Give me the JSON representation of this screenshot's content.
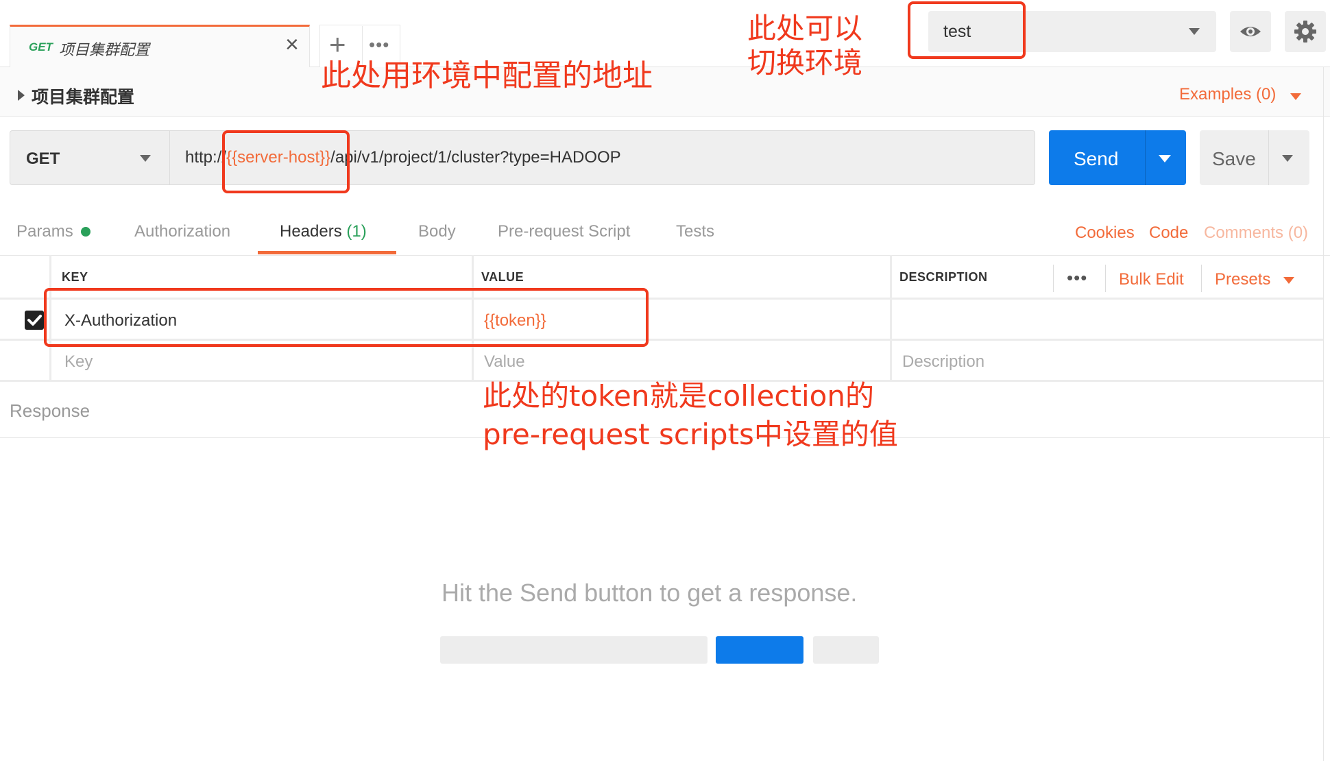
{
  "top_tab": {
    "method": "GET",
    "title": "项目集群配置"
  },
  "environment": {
    "selected": "test"
  },
  "breadcrumb": {
    "title": "项目集群配置",
    "examples_label": "Examples (0)"
  },
  "request": {
    "method": "GET",
    "url_prefix": "http://",
    "url_variable": "{{server-host}}",
    "url_suffix": "/api/v1/project/1/cluster?type=HADOOP",
    "send_label": "Send",
    "save_label": "Save"
  },
  "request_tabs": {
    "params": "Params",
    "authorization": "Authorization",
    "headers": "Headers",
    "headers_count": "(1)",
    "body": "Body",
    "pre_request_script": "Pre-request Script",
    "tests": "Tests",
    "cookies": "Cookies",
    "code": "Code",
    "comments": "Comments (0)"
  },
  "headers_table": {
    "columns": {
      "key": "KEY",
      "value": "VALUE",
      "description": "DESCRIPTION"
    },
    "bulk_edit": "Bulk Edit",
    "presets": "Presets",
    "rows": [
      {
        "checked": true,
        "key": "X-Authorization",
        "value": "{{token}}",
        "description": ""
      }
    ],
    "placeholders": {
      "key": "Key",
      "value": "Value",
      "description": "Description"
    }
  },
  "response": {
    "title": "Response",
    "hint": "Hit the Send button to get a response."
  },
  "annotations": {
    "url_note": "此处用环境中配置的地址",
    "env_note_line1": "此处可以",
    "env_note_line2": "切换环境",
    "token_note_line1": "此处的token就是collection的",
    "token_note_line2": "pre-request scripts中设置的值"
  },
  "colors": {
    "accent": "#f26b3a",
    "send_blue": "#0d7bea",
    "get_green": "#2aa05a",
    "annotation_red": "#f0391d"
  }
}
